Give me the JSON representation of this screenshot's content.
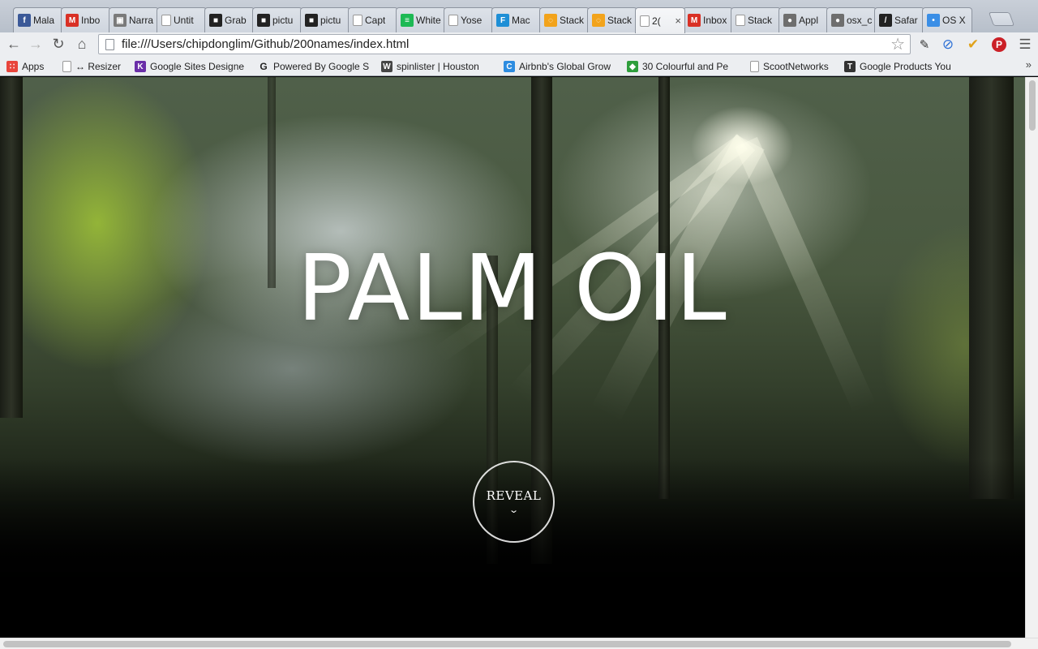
{
  "browser": {
    "tabs": [
      {
        "title": "Mala",
        "icon": "facebook-icon",
        "color": "#3b5998",
        "glyph": "f"
      },
      {
        "title": "Inbo",
        "icon": "gmail-icon",
        "color": "#d93025",
        "glyph": "M"
      },
      {
        "title": "Narra",
        "icon": "contact-icon",
        "color": "#7a7a7a",
        "glyph": "▣"
      },
      {
        "title": "Untit",
        "icon": "page-icon",
        "color": "#ffffff",
        "glyph": ""
      },
      {
        "title": "Grab",
        "icon": "media-icon",
        "color": "#222222",
        "glyph": "■"
      },
      {
        "title": "pictu",
        "icon": "media-icon",
        "color": "#222222",
        "glyph": "■"
      },
      {
        "title": "pictu",
        "icon": "media-icon",
        "color": "#222222",
        "glyph": "■"
      },
      {
        "title": "Capt",
        "icon": "page-icon",
        "color": "#ffffff",
        "glyph": ""
      },
      {
        "title": "White",
        "icon": "spotify-icon",
        "color": "#1db954",
        "glyph": "≡"
      },
      {
        "title": "Yose",
        "icon": "page-icon",
        "color": "#ffffff",
        "glyph": ""
      },
      {
        "title": "Mac",
        "icon": "f-icon",
        "color": "#1e8fd6",
        "glyph": "F"
      },
      {
        "title": "Stack",
        "icon": "loading-icon",
        "color": "#f2a31b",
        "glyph": "◌"
      },
      {
        "title": "Stack",
        "icon": "loading-icon",
        "color": "#f2a31b",
        "glyph": "◌"
      },
      {
        "title": "2(",
        "icon": "page-icon",
        "color": "#ffffff",
        "glyph": "",
        "active": true,
        "close": "×"
      },
      {
        "title": "Inbox",
        "icon": "gmail-icon",
        "color": "#d93025",
        "glyph": "M"
      },
      {
        "title": "Stack",
        "icon": "page-icon",
        "color": "#ffffff",
        "glyph": ""
      },
      {
        "title": "Appl",
        "icon": "apple-icon",
        "color": "#6e6e6e",
        "glyph": "●"
      },
      {
        "title": "osx_c",
        "icon": "apple-icon",
        "color": "#6e6e6e",
        "glyph": "●"
      },
      {
        "title": "Safar",
        "icon": "safari-icon",
        "color": "#222222",
        "glyph": "/"
      },
      {
        "title": "OS X",
        "icon": "pin-icon",
        "color": "#3a8ee6",
        "glyph": "•"
      }
    ],
    "address": "file:///Users/chipdonglim/Github/200names/index.html",
    "bookmarks": [
      {
        "label": "Apps",
        "icon": "apps-grid-icon",
        "color": "#e8453c",
        "glyph": "∷"
      },
      {
        "label": "↔ Resizer",
        "icon": "page-icon",
        "color": "#ffffff",
        "glyph": ""
      },
      {
        "label": "Google Sites Designe",
        "icon": "k-icon",
        "color": "#6a2ea8",
        "glyph": "K"
      },
      {
        "label": "Powered By Google S",
        "icon": "g-icon",
        "color": "#eceef1",
        "glyph": "G"
      },
      {
        "label": "spinlister | Houston",
        "icon": "wordpress-icon",
        "color": "#464646",
        "glyph": "W"
      },
      {
        "label": "Airbnb's Global Grow",
        "icon": "c-icon",
        "color": "#2d8ce0",
        "glyph": "C"
      },
      {
        "label": "30 Colourful and Pe",
        "icon": "leaf-icon",
        "color": "#2e9e3c",
        "glyph": "◆"
      },
      {
        "label": "ScootNetworks",
        "icon": "page-icon",
        "color": "#ffffff",
        "glyph": ""
      },
      {
        "label": "Google Products You",
        "icon": "t-icon",
        "color": "#333333",
        "glyph": "T"
      }
    ]
  },
  "page": {
    "title": "PALM OIL",
    "reveal_label": "REVEAL",
    "reveal_arrow": "⌄"
  }
}
